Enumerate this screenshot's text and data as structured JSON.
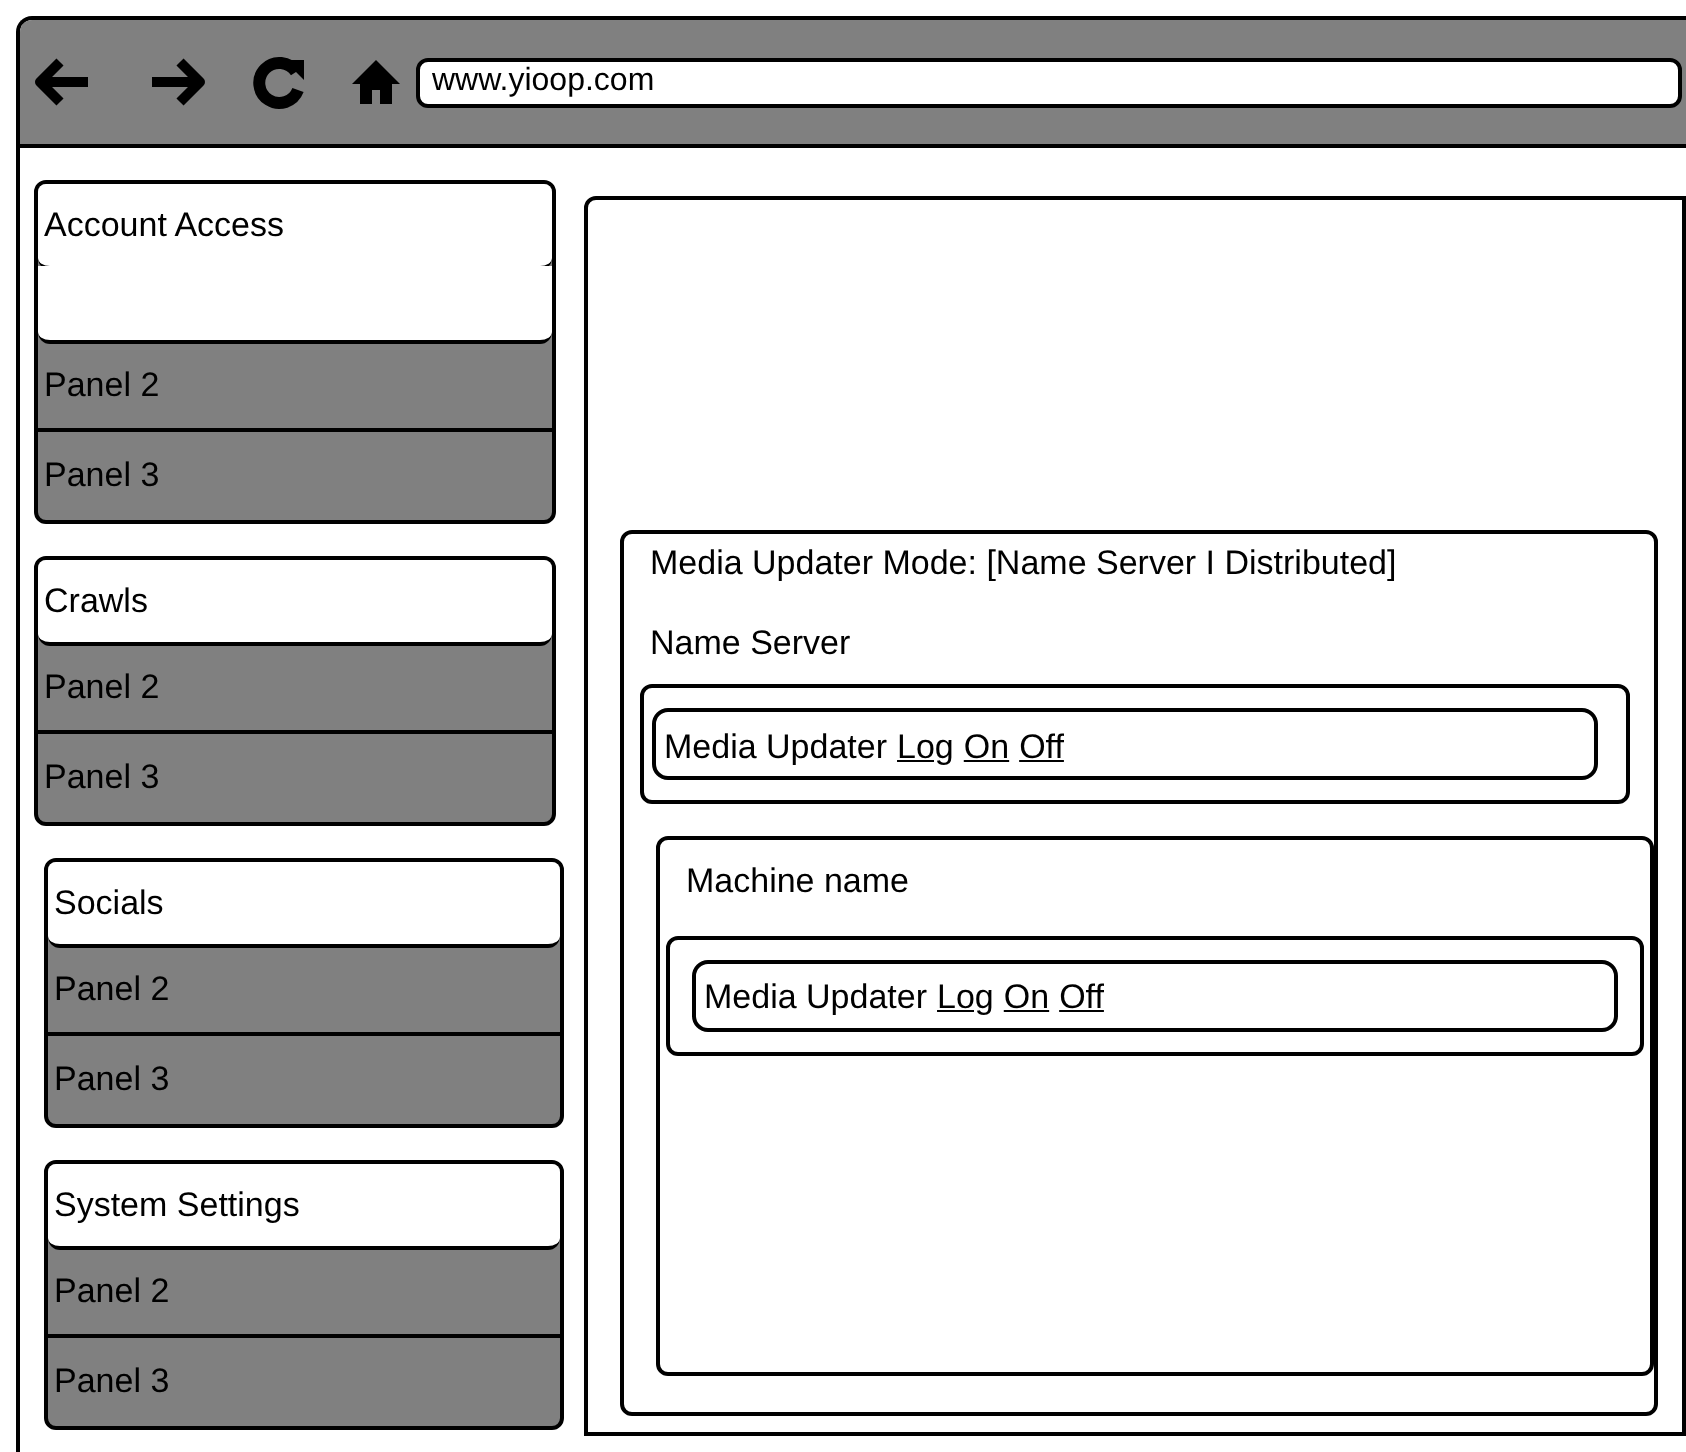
{
  "browser": {
    "address": "www.yioop.com"
  },
  "sidebar": {
    "groups": [
      {
        "title": "Account Access",
        "expanded": true,
        "panels": [
          "Panel 2",
          "Panel 3"
        ]
      },
      {
        "title": "Crawls",
        "expanded": false,
        "panels": [
          "Panel 2",
          "Panel 3"
        ]
      },
      {
        "title": "Socials",
        "expanded": false,
        "panels": [
          "Panel 2",
          "Panel 3"
        ]
      },
      {
        "title": "System Settings",
        "expanded": false,
        "panels": [
          "Panel 2",
          "Panel 3"
        ]
      }
    ]
  },
  "main": {
    "mode_label": "Media Updater Mode: [Name Server I Distributed]",
    "name_server": {
      "heading": "Name Server",
      "row": {
        "label": "Media Updater",
        "links": [
          "Log",
          "On",
          "Off"
        ]
      }
    },
    "machine": {
      "heading": "Machine name",
      "row": {
        "label": "Media Updater",
        "links": [
          "Log",
          "On",
          "Off"
        ]
      }
    }
  }
}
